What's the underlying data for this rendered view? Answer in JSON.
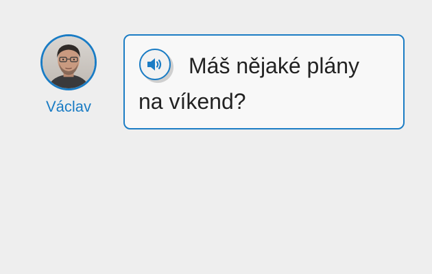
{
  "speaker": {
    "name": "Václav",
    "avatar_icon": "person-photo"
  },
  "message": {
    "text": "Máš nějaké plány na víkend?",
    "audio_icon": "speaker-volume-icon"
  },
  "colors": {
    "accent": "#1a7cc4",
    "background": "#eeeeee",
    "bubble": "#f8f8f8",
    "text": "#222222"
  }
}
